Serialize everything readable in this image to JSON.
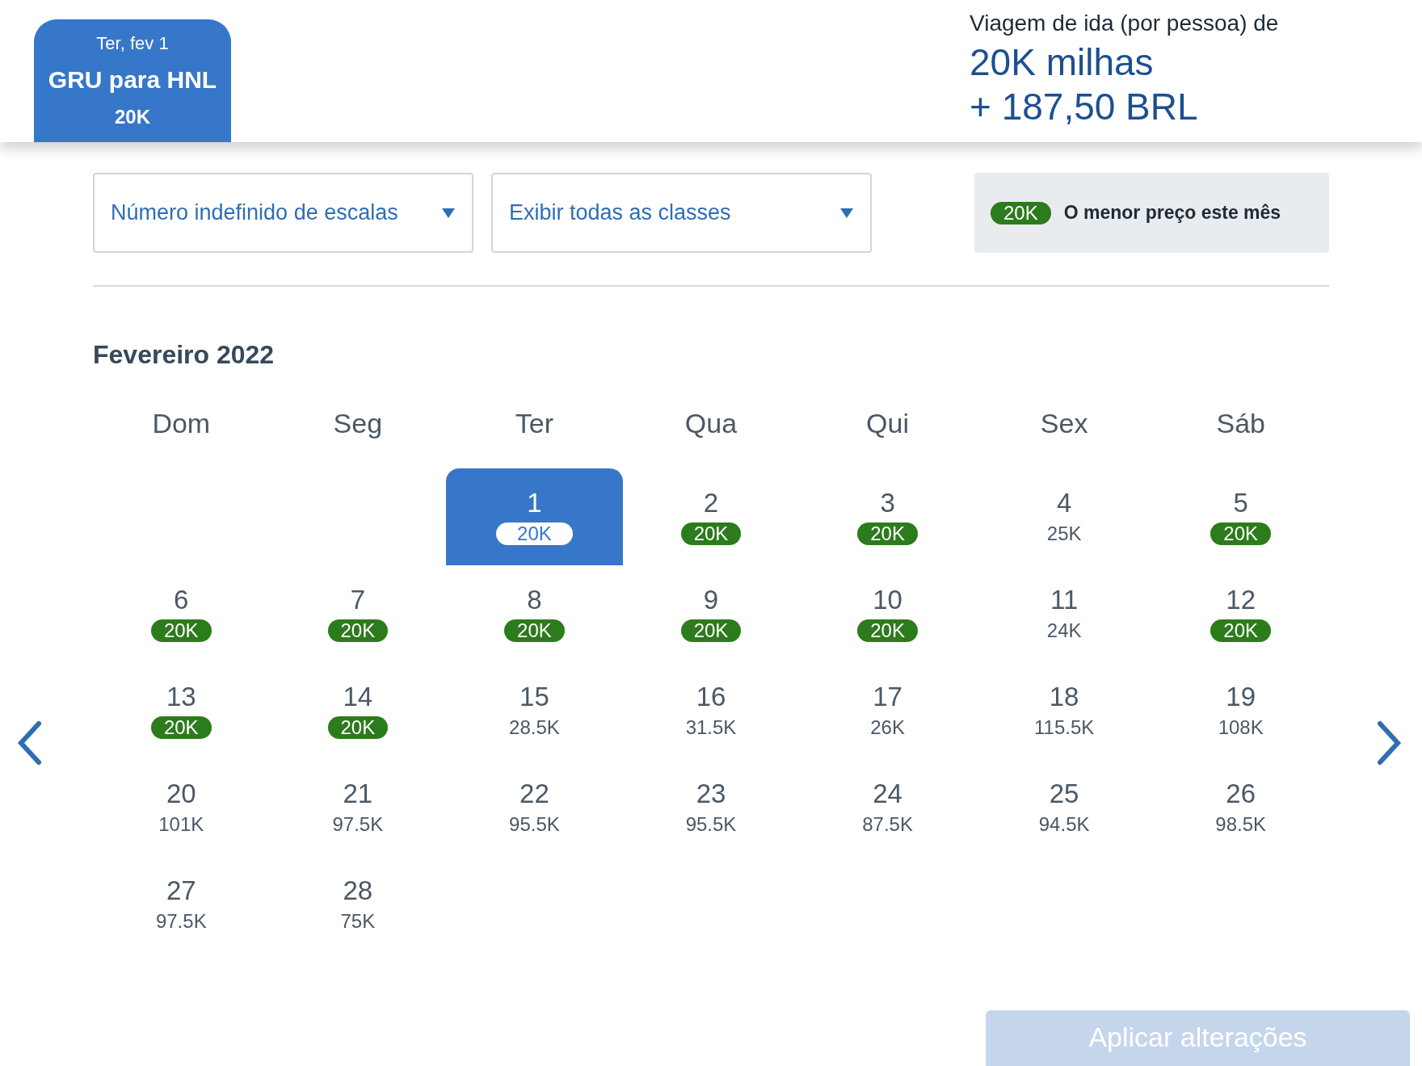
{
  "trip_tab": {
    "date": "Ter, fev 1",
    "route": "GRU para HNL",
    "price": "20K",
    "selected": true
  },
  "summary": {
    "label": "Viagem de ida (por pessoa) de",
    "miles": "20K milhas",
    "cash": "+ 187,50 BRL"
  },
  "filters": [
    {
      "value": "Número indefinido de escalas"
    },
    {
      "value": "Exibir todas as classes"
    }
  ],
  "legend": {
    "badge": "20K",
    "text": "O menor preço este mês"
  },
  "calendar": {
    "month": "Fevereiro 2022",
    "weekdays": [
      "Dom",
      "Seg",
      "Ter",
      "Qua",
      "Qui",
      "Sex",
      "Sáb"
    ],
    "weeks": [
      [
        {
          "day": "1",
          "price": "20K",
          "lowest": true,
          "selected": true
        },
        {
          "day": "2",
          "price": "20K",
          "lowest": true,
          "selected": false
        },
        {
          "day": "3",
          "price": "20K",
          "lowest": true,
          "selected": false
        },
        {
          "day": "4",
          "price": "25K",
          "lowest": false,
          "selected": false
        },
        {
          "day": "5",
          "price": "20K",
          "lowest": true,
          "selected": false
        }
      ],
      [
        {
          "day": "6",
          "price": "20K",
          "lowest": true,
          "selected": false
        },
        {
          "day": "7",
          "price": "20K",
          "lowest": true,
          "selected": false
        },
        {
          "day": "8",
          "price": "20K",
          "lowest": true,
          "selected": false
        },
        {
          "day": "9",
          "price": "20K",
          "lowest": true,
          "selected": false
        },
        {
          "day": "10",
          "price": "20K",
          "lowest": true,
          "selected": false
        },
        {
          "day": "11",
          "price": "24K",
          "lowest": false,
          "selected": false
        },
        {
          "day": "12",
          "price": "20K",
          "lowest": true,
          "selected": false
        }
      ],
      [
        {
          "day": "13",
          "price": "20K",
          "lowest": true,
          "selected": false
        },
        {
          "day": "14",
          "price": "20K",
          "lowest": true,
          "selected": false
        },
        {
          "day": "15",
          "price": "28.5K",
          "lowest": false,
          "selected": false
        },
        {
          "day": "16",
          "price": "31.5K",
          "lowest": false,
          "selected": false
        },
        {
          "day": "17",
          "price": "26K",
          "lowest": false,
          "selected": false
        },
        {
          "day": "18",
          "price": "115.5K",
          "lowest": false,
          "selected": false
        },
        {
          "day": "19",
          "price": "108K",
          "lowest": false,
          "selected": false
        }
      ],
      [
        {
          "day": "20",
          "price": "101K",
          "lowest": false,
          "selected": false
        },
        {
          "day": "21",
          "price": "97.5K",
          "lowest": false,
          "selected": false
        },
        {
          "day": "22",
          "price": "95.5K",
          "lowest": false,
          "selected": false
        },
        {
          "day": "23",
          "price": "95.5K",
          "lowest": false,
          "selected": false
        },
        {
          "day": "24",
          "price": "87.5K",
          "lowest": false,
          "selected": false
        },
        {
          "day": "25",
          "price": "94.5K",
          "lowest": false,
          "selected": false
        },
        {
          "day": "26",
          "price": "98.5K",
          "lowest": false,
          "selected": false
        }
      ],
      [
        {
          "day": "27",
          "price": "97.5K",
          "lowest": false,
          "selected": false
        },
        {
          "day": "28",
          "price": "75K",
          "lowest": false,
          "selected": false
        }
      ]
    ]
  },
  "apply_button": {
    "label": "Aplicar alterações",
    "disabled": true
  }
}
